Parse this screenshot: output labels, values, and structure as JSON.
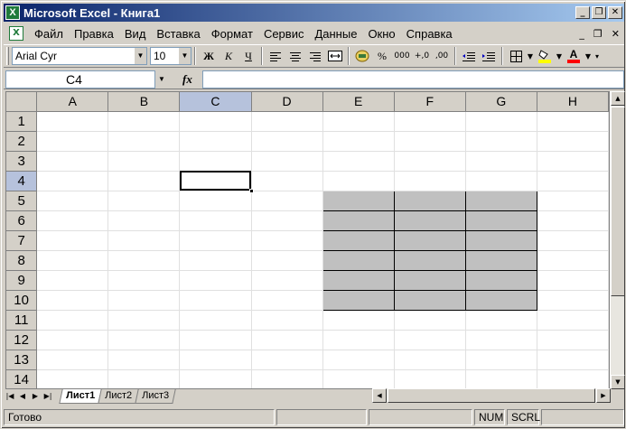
{
  "titlebar": {
    "title": "Microsoft Excel - Книга1",
    "app_icon": "excel-icon",
    "minimize": "_",
    "restore": "❐",
    "close": "✕"
  },
  "menubar": {
    "items": [
      "Файл",
      "Правка",
      "Вид",
      "Вставка",
      "Формат",
      "Сервис",
      "Данные",
      "Окно",
      "Справка"
    ],
    "mdi_minimize": "_",
    "mdi_restore": "❐",
    "mdi_close": "✕"
  },
  "toolbar": {
    "font": "Arial Cyr",
    "size": "10",
    "bold": "Ж",
    "italic": "К",
    "underline": "Ч",
    "percent": "%",
    "thousands": "000",
    "inc_decimal": "+,0",
    "dec_decimal": ",00",
    "font_color_label": "A",
    "fill_color": "#ffff00",
    "font_color": "#ff0000"
  },
  "formulabar": {
    "namebox": "C4",
    "fx": "fx",
    "formula": ""
  },
  "grid": {
    "columns": [
      "A",
      "B",
      "C",
      "D",
      "E",
      "F",
      "G",
      "H"
    ],
    "rows": [
      "1",
      "2",
      "3",
      "4",
      "5",
      "6",
      "7",
      "8",
      "9",
      "10",
      "11",
      "12",
      "13",
      "14"
    ],
    "active_cell": "C4",
    "shaded_range": "E5:G10",
    "shade_color": "#c0c0c0"
  },
  "sheets": {
    "tabs": [
      "Лист1",
      "Лист2",
      "Лист3"
    ],
    "active": "Лист1"
  },
  "statusbar": {
    "status": "Готово",
    "num": "NUM",
    "scrl": "SCRL"
  }
}
